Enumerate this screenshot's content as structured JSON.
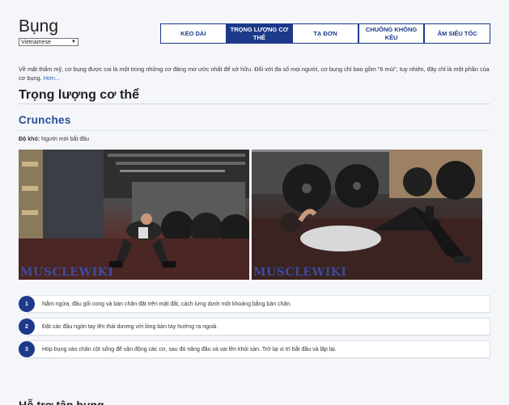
{
  "page": {
    "title": "Bụng",
    "language": "Vietnamese"
  },
  "tabs": [
    {
      "label": "KÉO DÀI",
      "active": false
    },
    {
      "label": "TRỌNG LƯỢNG CƠ THỂ",
      "active": true
    },
    {
      "label": "TẠ ĐƠN",
      "active": false
    },
    {
      "label": "CHUÔNG KHÔNG KÊU",
      "active": false
    },
    {
      "label": "ÂM SIÊU TỐC",
      "active": false
    }
  ],
  "intro": {
    "text": "Về mặt thẩm mỹ, cơ bụng được coi là một trong những cơ đáng mơ ước nhất để sở hữu. Đối với đa số mọi người, cơ bụng chỉ bao gồm \"6 múi\", tuy nhiên, đây chỉ là một phần của cơ bụng.",
    "more": "Hơn..."
  },
  "section": {
    "title": "Trọng lượng cơ thể"
  },
  "exercise": {
    "title": "Crunches",
    "difficulty_label": "Độ khó:",
    "difficulty_value": "Người mới bắt đầu",
    "watermark": "MUSCLEWIKI",
    "steps": [
      {
        "num": "1",
        "text": "Nằm ngửa, đầu gối cong và bàn chân đặt trên mặt đất, cách lưng dưới một khoảng bằng bàn chân."
      },
      {
        "num": "2",
        "text": "Đặt các đầu ngón tay lên thái dương với lòng bàn tay hướng ra ngoài."
      },
      {
        "num": "3",
        "text": "Hóp bụng vào chân cột sống để vận động các cơ, sau đó nâng đầu và vai lên khỏi sàn. Trở lại vị trí bắt đầu và lặp lại."
      }
    ]
  },
  "next_section": {
    "title": "Hỗ trợ tập bụng"
  },
  "colors": {
    "brand": "#1d3a8a",
    "link": "#2a5db0",
    "exercise_title": "#2b4d9a"
  }
}
